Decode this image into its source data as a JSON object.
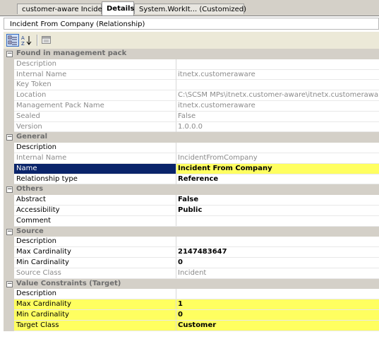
{
  "tabs": [
    {
      "label": "customer-aware Incident"
    },
    {
      "label": "Details"
    },
    {
      "label": "System.WorkIt... (Customized)"
    }
  ],
  "title": "Incident From Company (Relationship)",
  "toolbar": {
    "categorized_icon": "categorized-view-icon",
    "alphabetical_icon": "alphabetical-sort-icon",
    "pages_icon": "property-pages-icon"
  },
  "rows": [
    {
      "kind": "cat",
      "name": "Found in management pack"
    },
    {
      "kind": "ro",
      "name": "Description",
      "value": ""
    },
    {
      "kind": "ro",
      "name": "Internal Name",
      "value": "itnetx.customeraware"
    },
    {
      "kind": "ro",
      "name": "Key Token",
      "value": ""
    },
    {
      "kind": "ro",
      "name": "Location",
      "value": "C:\\SCSM MPs\\itnetx.customer-aware\\itnetx.customeraware.xml"
    },
    {
      "kind": "ro",
      "name": "Management Pack Name",
      "value": "itnetx.customeraware"
    },
    {
      "kind": "ro",
      "name": "Sealed",
      "value": "False"
    },
    {
      "kind": "ro",
      "name": "Version",
      "value": "1.0.0.0"
    },
    {
      "kind": "cat",
      "name": "General"
    },
    {
      "kind": "edit",
      "name": "Description",
      "value": ""
    },
    {
      "kind": "ro",
      "name": "Internal Name",
      "value": "IncidentFromCompany"
    },
    {
      "kind": "hl-sel",
      "name": "Name",
      "value": "Incident From Company"
    },
    {
      "kind": "bold",
      "name": "Relationship type",
      "value": "Reference"
    },
    {
      "kind": "cat",
      "name": "Others"
    },
    {
      "kind": "bold",
      "name": "Abstract",
      "value": "False"
    },
    {
      "kind": "bold",
      "name": "Accessibility",
      "value": "Public"
    },
    {
      "kind": "edit",
      "name": "Comment",
      "value": ""
    },
    {
      "kind": "cat",
      "name": "Source"
    },
    {
      "kind": "edit",
      "name": "Description",
      "value": ""
    },
    {
      "kind": "bold",
      "name": "Max Cardinality",
      "value": "2147483647"
    },
    {
      "kind": "bold",
      "name": "Min Cardinality",
      "value": "0"
    },
    {
      "kind": "ro",
      "name": "Source Class",
      "value": "Incident"
    },
    {
      "kind": "cat",
      "name": "Value Constraints (Target)"
    },
    {
      "kind": "edit",
      "name": "Description",
      "value": ""
    },
    {
      "kind": "hl",
      "name": "Max Cardinality",
      "value": "1"
    },
    {
      "kind": "hl",
      "name": "Min Cardinality",
      "value": "0"
    },
    {
      "kind": "hl",
      "name": "Target Class",
      "value": "Customer"
    }
  ],
  "colors": {
    "highlight": "#ffff60",
    "selection": "#0a246a",
    "category_bg": "#d4d0c8"
  }
}
